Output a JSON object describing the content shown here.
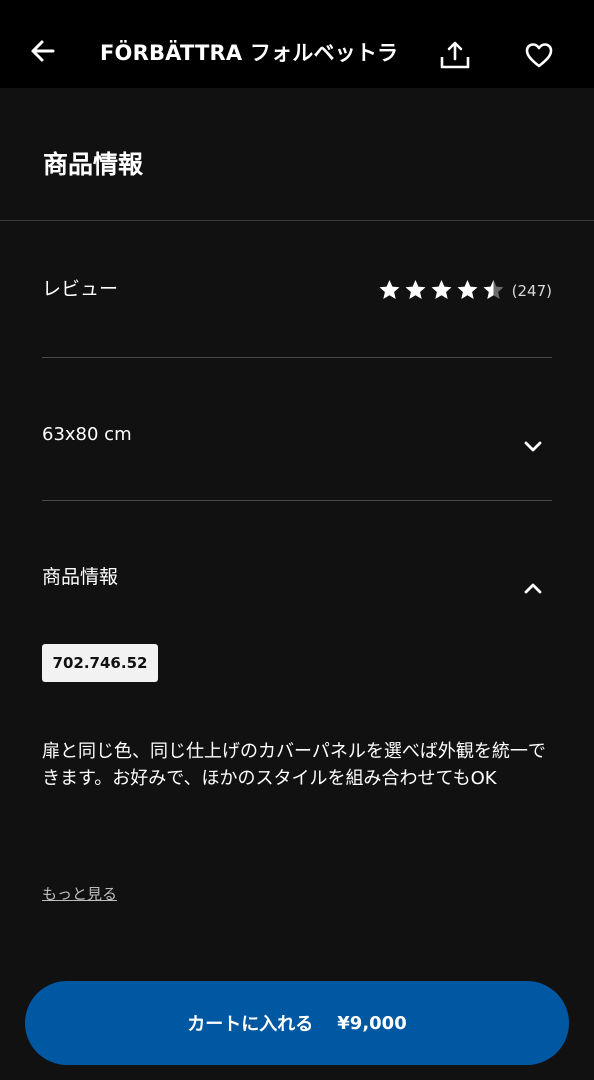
{
  "header": {
    "title": "FÖRBÄTTRA フォルベットラ",
    "icons": {
      "back": "back-arrow-icon",
      "share": "share-icon",
      "favorite": "heart-icon"
    }
  },
  "section": {
    "heading": "商品情報"
  },
  "reviews": {
    "label": "レビュー",
    "rating": 4.5,
    "max_rating": 5,
    "count_text": "(247)"
  },
  "size": {
    "label": "63x80 cm"
  },
  "product_info": {
    "label": "商品情報",
    "article_number": "702.746.52",
    "description": "扉と同じ色、同じ仕上げのカバーパネルを選べば外観を統一できます。お好みで、ほかのスタイルを組み合わせてもOK",
    "more_link": "もっと見る"
  },
  "cart": {
    "label": "カートに入れる",
    "price": "¥9,000"
  },
  "colors": {
    "background": "#111111",
    "header": "#000000",
    "accent": "#0058a3",
    "divider": "#4a4a4a"
  }
}
